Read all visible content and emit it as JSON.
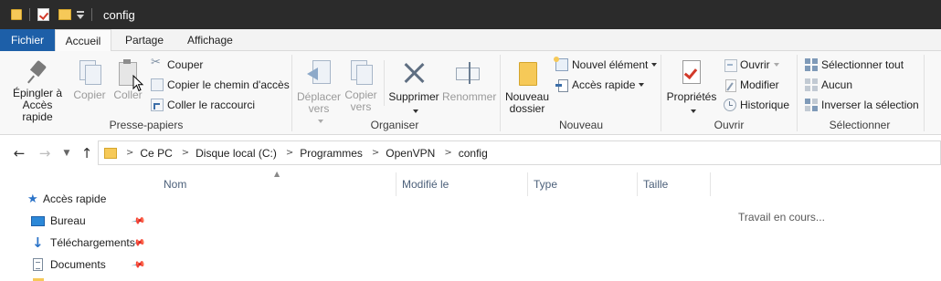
{
  "window": {
    "title": "config"
  },
  "ribbon_tabs": [
    {
      "label": "Fichier"
    },
    {
      "label": "Accueil"
    },
    {
      "label": "Partage"
    },
    {
      "label": "Affichage"
    }
  ],
  "ribbon": {
    "clipboard": {
      "group_label": "Presse-papiers",
      "pin_line1": "Épingler à",
      "pin_line2": "Accès rapide",
      "copy": "Copier",
      "paste": "Coller",
      "cut": "Couper",
      "copy_path": "Copier le chemin d'accès",
      "paste_shortcut": "Coller le raccourci"
    },
    "organize": {
      "group_label": "Organiser",
      "move_line1": "Déplacer",
      "move_line2": "vers",
      "copyto_line1": "Copier",
      "copyto_line2": "vers",
      "delete": "Supprimer",
      "rename": "Renommer"
    },
    "new": {
      "group_label": "Nouveau",
      "newfolder_line1": "Nouveau",
      "newfolder_line2": "dossier",
      "new_item": "Nouvel élément",
      "easy_access": "Accès rapide"
    },
    "open": {
      "group_label": "Ouvrir",
      "properties": "Propriétés",
      "open": "Ouvrir",
      "edit": "Modifier",
      "history": "Historique"
    },
    "select": {
      "group_label": "Sélectionner",
      "select_all": "Sélectionner tout",
      "select_none": "Aucun",
      "invert": "Inverser la sélection"
    }
  },
  "address": {
    "breadcrumbs": [
      "Ce PC",
      "Disque local (C:)",
      "Programmes",
      "OpenVPN",
      "config"
    ]
  },
  "nav_pane": {
    "items": [
      {
        "label": "Accès rapide",
        "icon": "star-icon"
      },
      {
        "label": "Bureau",
        "icon": "desktop-icon",
        "pinned": true
      },
      {
        "label": "Téléchargements",
        "icon": "download-icon",
        "pinned": true
      },
      {
        "label": "Documents",
        "icon": "documents-icon",
        "pinned": true
      }
    ]
  },
  "file_list": {
    "columns": [
      "Nom",
      "Modifié le",
      "Type",
      "Taille"
    ],
    "status": "Travail en cours..."
  },
  "colors": {
    "titlebar": "#2b2b2b",
    "file_tab": "#1d5fa8",
    "folder": "#f6c958",
    "accent_blue": "#2b73c8"
  }
}
